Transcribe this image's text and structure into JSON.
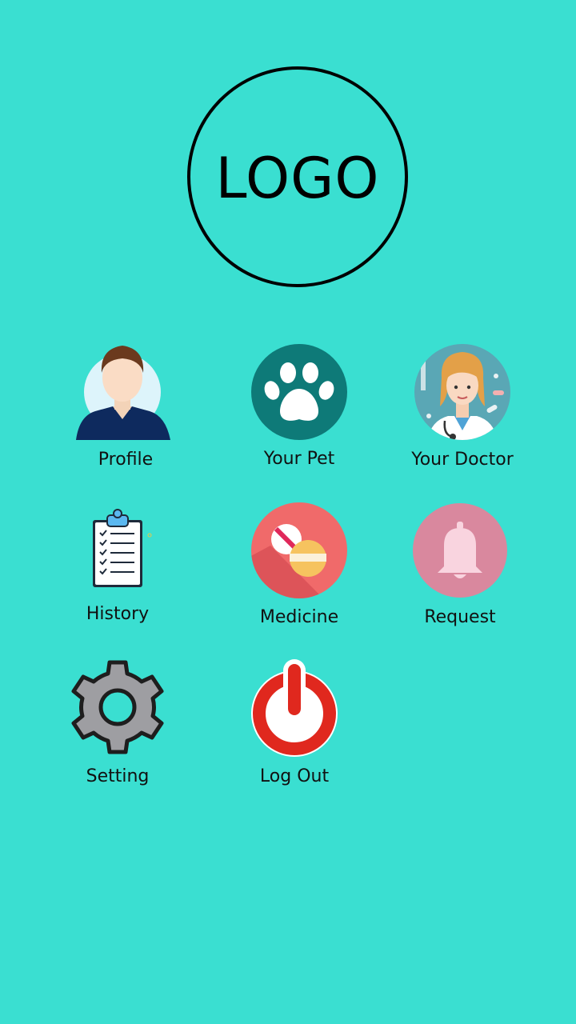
{
  "logo": {
    "text": "LOGO"
  },
  "menu": {
    "profile": {
      "label": "Profile",
      "icon": "user-avatar-icon"
    },
    "your_pet": {
      "label": "Your Pet",
      "icon": "paw-icon"
    },
    "your_doctor": {
      "label": "Your Doctor",
      "icon": "doctor-avatar-icon"
    },
    "history": {
      "label": "History",
      "icon": "clipboard-checklist-icon"
    },
    "medicine": {
      "label": "Medicine",
      "icon": "pills-icon"
    },
    "request": {
      "label": "Request",
      "icon": "bell-icon"
    },
    "setting": {
      "label": "Setting",
      "icon": "gear-icon"
    },
    "log_out": {
      "label": "Log Out",
      "icon": "power-icon"
    }
  },
  "colors": {
    "background": "#3ADFD1",
    "paw_circle": "#0E7A78",
    "medicine_circle": "#F06A6A",
    "request_circle": "#D9889E",
    "power_red": "#E0281E"
  }
}
